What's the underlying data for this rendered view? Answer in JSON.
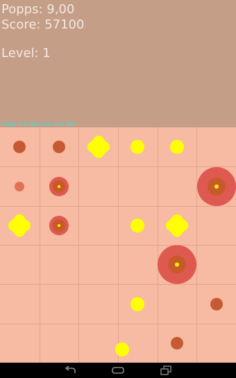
{
  "hud": {
    "popps": "Popps: 9,00",
    "score": "Score: 57100",
    "level": "Level: 1"
  },
  "board": {
    "tagline": "Clear The Skin For The Win",
    "cols": 6,
    "rows": 6,
    "colors": {
      "background": "#f7bba3",
      "grid": "#e2a48d",
      "small_pimple": "#c65a34",
      "small_pimple_light": "#e27255",
      "red_zone": "#de5a50",
      "red_core": "#c85a2a",
      "yellow": "#ffff00",
      "center_dot": "#ffee00"
    },
    "cells": [
      {
        "col": 0,
        "row": 0,
        "kind": "small"
      },
      {
        "col": 1,
        "row": 0,
        "kind": "small"
      },
      {
        "col": 2,
        "row": 0,
        "kind": "yellow-blob"
      },
      {
        "col": 3,
        "row": 0,
        "kind": "yellow"
      },
      {
        "col": 4,
        "row": 0,
        "kind": "yellow"
      },
      {
        "col": 0,
        "row": 1,
        "kind": "small-light"
      },
      {
        "col": 1,
        "row": 1,
        "kind": "medium"
      },
      {
        "col": 5,
        "row": 1,
        "kind": "large"
      },
      {
        "col": 0,
        "row": 2,
        "kind": "yellow-blob"
      },
      {
        "col": 1,
        "row": 2,
        "kind": "medium"
      },
      {
        "col": 3,
        "row": 2,
        "kind": "yellow"
      },
      {
        "col": 4,
        "row": 2,
        "kind": "yellow-blob"
      },
      {
        "col": 4,
        "row": 3,
        "kind": "large"
      },
      {
        "col": 3,
        "row": 4,
        "kind": "yellow"
      },
      {
        "col": 5,
        "row": 4,
        "kind": "small"
      },
      {
        "col": 3,
        "row": 5,
        "kind": "yellow-offset"
      },
      {
        "col": 4,
        "row": 5,
        "kind": "small"
      }
    ]
  },
  "navbar": {
    "buttons": [
      {
        "name": "back-icon"
      },
      {
        "name": "home-icon"
      },
      {
        "name": "recent-apps-icon"
      }
    ]
  }
}
